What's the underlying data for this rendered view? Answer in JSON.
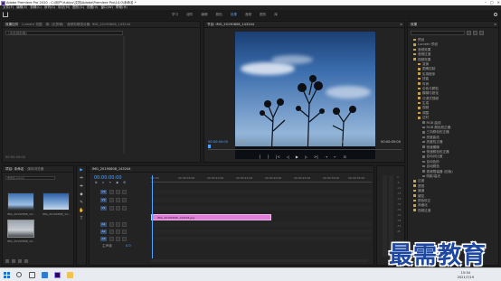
{
  "window": {
    "title": "Adobe Premiere Pro 2020 - C:\\用户\\Yubiyu\\文档\\Adobe\\Premiere Pro\\14.0\\未命名 *"
  },
  "menu": [
    "文件(F)",
    "编辑(E)",
    "剪辑(C)",
    "序列(S)",
    "标记(M)",
    "图形(G)",
    "视图(V)",
    "窗口(W)",
    "帮助(H)"
  ],
  "workspaces": [
    "学习",
    "组件",
    "编辑",
    "颜色",
    "效果",
    "音频",
    "图形",
    "库"
  ],
  "workspace_active_index": 4,
  "source_panel": {
    "tabs": [
      "效果控件",
      "Lumetri 范围",
      "源: (无剪辑)",
      "音频剪辑混合器: IMG_20190808_143244"
    ],
    "dropdown": "(未选择剪辑)",
    "timecode": "00:00:00:00"
  },
  "program_monitor": {
    "title": "节目: IMG_20190808_143244",
    "timecode_left": "00:00:00:00",
    "fit": "适合",
    "ratio": "1/2",
    "timecode_right": "00:00:05:00"
  },
  "transport": [
    "{",
    "}",
    "|<",
    "◁",
    "▶",
    "▷",
    ">|",
    "⇢",
    "⇠",
    "⊡"
  ],
  "effects_panel": {
    "title": "效果",
    "items": [
      {
        "label": "预设",
        "leaf": false
      },
      {
        "label": "Lumetri 预设",
        "leaf": false
      },
      {
        "label": "音频效果",
        "leaf": false
      },
      {
        "label": "音频过渡",
        "leaf": false
      },
      {
        "label": "视频效果",
        "leaf": false
      },
      {
        "label": "变换",
        "leaf": false
      },
      {
        "label": "图像控制",
        "leaf": false
      },
      {
        "label": "实用程序",
        "leaf": false
      },
      {
        "label": "扭曲",
        "leaf": false
      },
      {
        "label": "时间",
        "leaf": false
      },
      {
        "label": "杂色与颗粒",
        "leaf": false
      },
      {
        "label": "模糊与锐化",
        "leaf": false
      },
      {
        "label": "沉浸式视频",
        "leaf": false
      },
      {
        "label": "生成",
        "leaf": false
      },
      {
        "label": "视频",
        "leaf": false
      },
      {
        "label": "调整",
        "leaf": false
      },
      {
        "label": "过时",
        "leaf": false
      },
      {
        "label": "RGB 曲线",
        "leaf": true
      },
      {
        "label": "RGB 颜色校正器",
        "leaf": true
      },
      {
        "label": "三向颜色校正器",
        "leaf": true
      },
      {
        "label": "亮度曲线",
        "leaf": true
      },
      {
        "label": "亮度校正器",
        "leaf": true
      },
      {
        "label": "快速模糊",
        "leaf": true
      },
      {
        "label": "快速颜色校正器",
        "leaf": true
      },
      {
        "label": "自动对比度",
        "leaf": true
      },
      {
        "label": "自动色阶",
        "leaf": true
      },
      {
        "label": "自动颜色",
        "leaf": true
      },
      {
        "label": "视频限幅器 (旧版)",
        "leaf": true
      },
      {
        "label": "阴影/高光",
        "leaf": true
      },
      {
        "label": "过渡",
        "leaf": false
      },
      {
        "label": "透视",
        "leaf": false
      },
      {
        "label": "通道",
        "leaf": false
      },
      {
        "label": "键控",
        "leaf": false
      },
      {
        "label": "颜色校正",
        "leaf": false
      },
      {
        "label": "风格化",
        "leaf": false
      },
      {
        "label": "视频过渡",
        "leaf": false
      }
    ]
  },
  "project_panel": {
    "tabs": [
      "项目: 未命名",
      "媒体浏览器"
    ],
    "file": "未命名.prproj",
    "items": [
      {
        "label": "IMG_20190808_14..."
      },
      {
        "label": "IMG_20190808_14..."
      },
      {
        "label": "IMG_20190808_14..."
      }
    ]
  },
  "tools": [
    "▶",
    "⇹",
    "⇼",
    "◆",
    "✎",
    "✋",
    "T"
  ],
  "timeline": {
    "tab": "IMG_20190808_143244",
    "timecode": "00:00:00:00",
    "ruler": [
      "00:00",
      "00:00:05:00",
      "00:00:10:00",
      "00:00:15:00",
      "00:00:20:00",
      "00:00:25:00",
      "00:00:30:00",
      "00:00:35:00"
    ],
    "tracks": [
      "V3",
      "V2",
      "V1",
      "A1",
      "A2",
      "A3"
    ],
    "clip_label": "IMG_20190808_143244.jpg",
    "master_label": "主声道",
    "master_value": "0.0"
  },
  "meters": {
    "scale": [
      "0",
      "-6",
      "-12",
      "-18",
      "-24",
      "-30",
      "-36",
      "-42",
      "-48",
      "-54",
      "dB"
    ]
  },
  "taskbar": {
    "time": "15:34",
    "date": "2021/7/19"
  },
  "watermark": "最需教育"
}
